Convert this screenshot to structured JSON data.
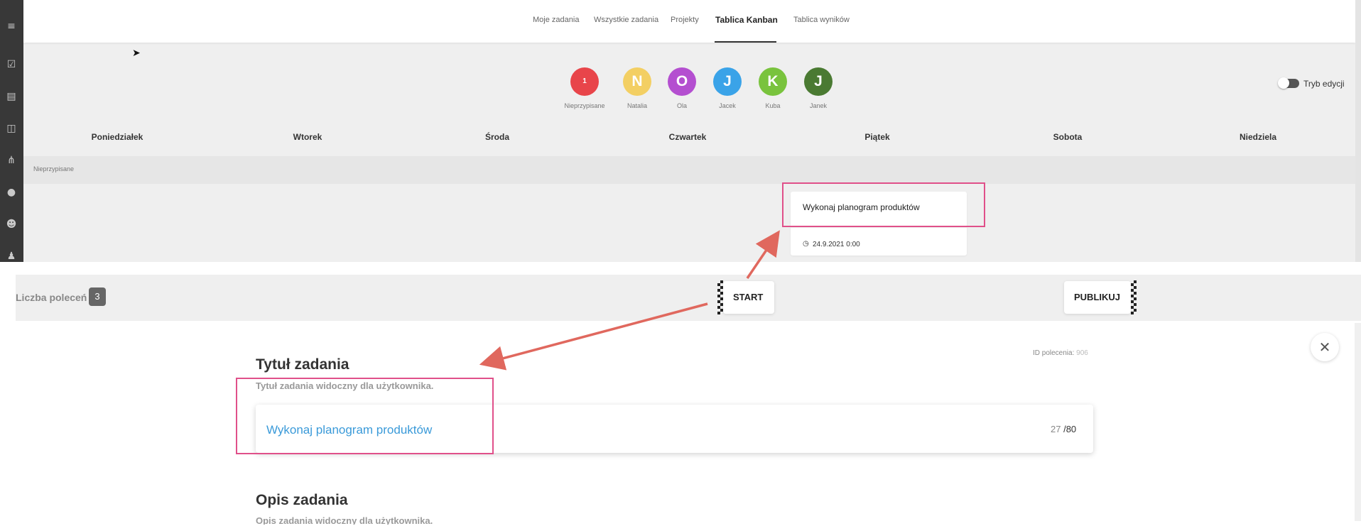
{
  "nav": {
    "items": [
      {
        "label": "Moje zadania"
      },
      {
        "label": "Wszystkie zadania"
      },
      {
        "label": "Projekty"
      },
      {
        "label": "Tablica Kanban"
      },
      {
        "label": "Tablica wyników"
      }
    ],
    "active": "Tablica Kanban"
  },
  "sidebar": {
    "icons": [
      "menu-icon",
      "task-check-icon",
      "list-icon",
      "board-icon",
      "flow-icon",
      "location-pin-icon",
      "users-icon",
      "user-settings-icon"
    ]
  },
  "assignees": [
    {
      "initial": "1",
      "label": "Nieprzypisane",
      "color": "#e8454a"
    },
    {
      "initial": "N",
      "label": "Natalia",
      "color": "#f3cf63"
    },
    {
      "initial": "O",
      "label": "Ola",
      "color": "#b44fd0"
    },
    {
      "initial": "J",
      "label": "Jacek",
      "color": "#3aa3e8"
    },
    {
      "initial": "K",
      "label": "Kuba",
      "color": "#79c33d"
    },
    {
      "initial": "J",
      "label": "Janek",
      "color": "#4a7a32"
    }
  ],
  "edit_mode": {
    "label": "Tryb edycji",
    "enabled": false
  },
  "days": [
    "Poniedziałek",
    "Wtorek",
    "Środa",
    "Czwartek",
    "Piątek",
    "Sobota",
    "Niedziela"
  ],
  "unassigned_row": {
    "label": "Nieprzypisane"
  },
  "task_card": {
    "title": "Wykonaj planogram produktów",
    "date": "24.9.2021 0:00"
  },
  "steps_bar": {
    "count_label": "Liczba poleceń",
    "count_value": "3",
    "start_label": "START",
    "publish_label": "PUBLIKUJ"
  },
  "form": {
    "id_label": "ID polecenia:",
    "id_value": "906",
    "title_heading": "Tytuł zadania",
    "title_hint": "Tytuł zadania widoczny dla użytkownika.",
    "title_value": "Wykonaj planogram produktów",
    "char_count": "27",
    "char_max": "/80",
    "desc_heading": "Opis zadania",
    "desc_hint": "Opis zadania widoczny dla użytkownika."
  },
  "colors": {
    "highlight": "#e0508a",
    "arrow": "#e0685e",
    "link": "#3a9ad9",
    "sidebar": "#383838"
  }
}
